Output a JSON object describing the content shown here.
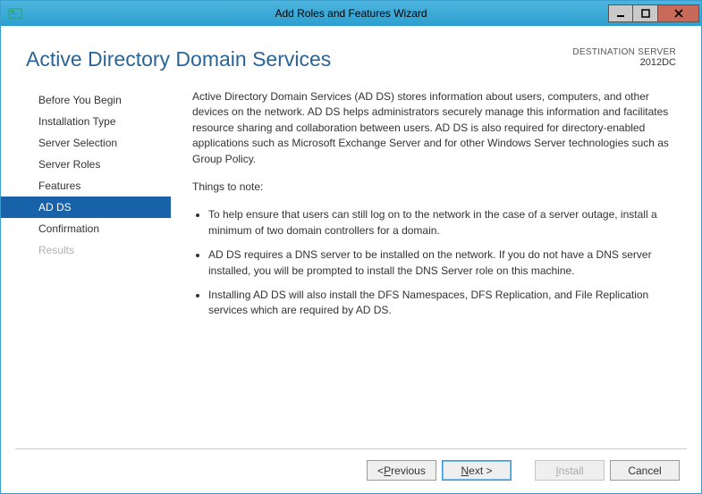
{
  "window": {
    "title": "Add Roles and Features Wizard"
  },
  "header": {
    "page_title": "Active Directory Domain Services",
    "dest_label": "DESTINATION SERVER",
    "dest_server": "2012DC"
  },
  "sidebar": {
    "items": [
      {
        "label": "Before You Begin",
        "state": "normal"
      },
      {
        "label": "Installation Type",
        "state": "normal"
      },
      {
        "label": "Server Selection",
        "state": "normal"
      },
      {
        "label": "Server Roles",
        "state": "normal"
      },
      {
        "label": "Features",
        "state": "normal"
      },
      {
        "label": "AD DS",
        "state": "selected"
      },
      {
        "label": "Confirmation",
        "state": "normal"
      },
      {
        "label": "Results",
        "state": "disabled"
      }
    ]
  },
  "content": {
    "intro": "Active Directory Domain Services (AD DS) stores information about users, computers, and other devices on the network.  AD DS helps administrators securely manage this information and facilitates resource sharing and collaboration between users.  AD DS is also required for directory-enabled applications such as Microsoft Exchange Server and for other Windows Server technologies such as Group Policy.",
    "note_heading": "Things to note:",
    "bullets": [
      "To help ensure that users can still log on to the network in the case of a server outage, install a minimum of two domain controllers for a domain.",
      "AD DS requires a DNS server to be installed on the network.  If you do not have a DNS server installed, you will be prompted to install the DNS Server role on this machine.",
      "Installing AD DS will also install the DFS Namespaces, DFS Replication, and File Replication services which are required by AD DS."
    ]
  },
  "footer": {
    "previous_pre": "< ",
    "previous_u": "P",
    "previous_post": "revious",
    "next_u": "N",
    "next_post": "ext >",
    "install_u": "I",
    "install_post": "nstall",
    "cancel": "Cancel"
  }
}
